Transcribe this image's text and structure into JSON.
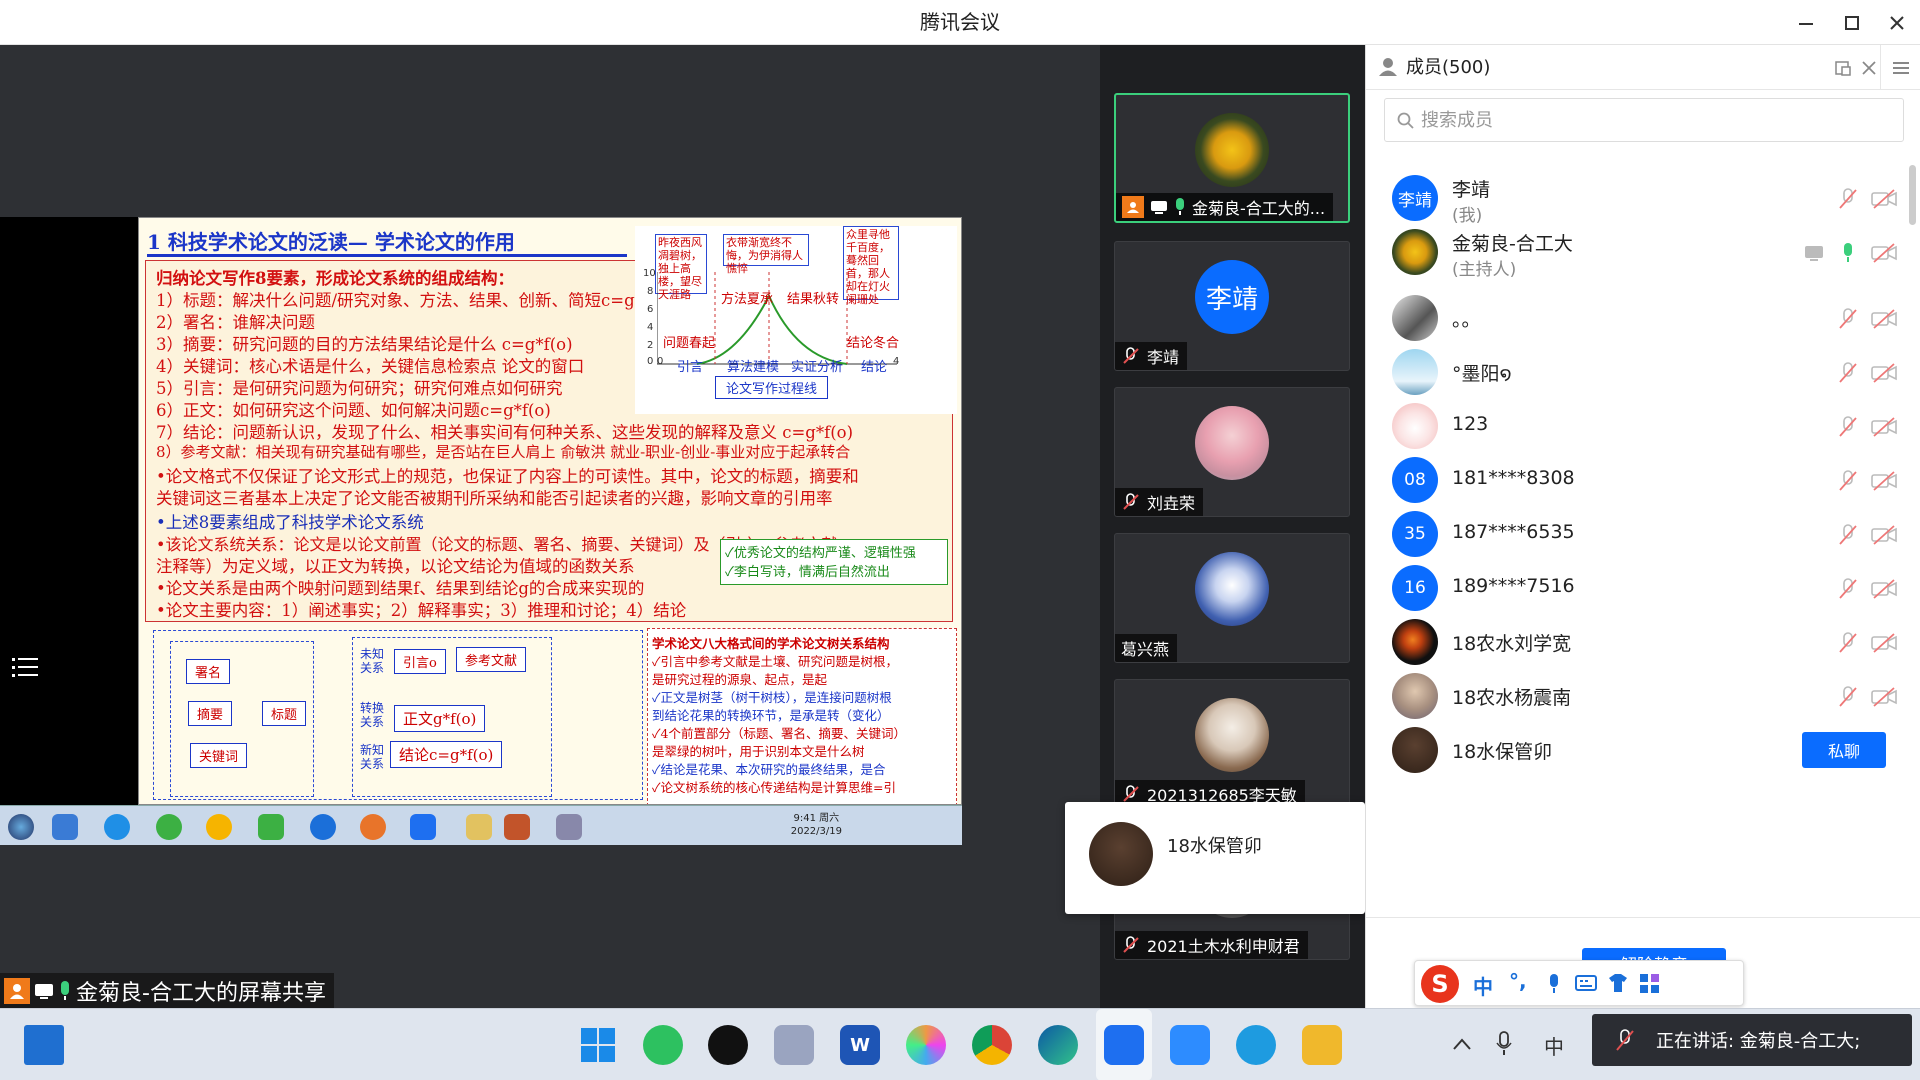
{
  "window": {
    "title": "腾讯会议"
  },
  "slide": {
    "title": "1 科技学术论文的泛读— 学术论文的作用",
    "lines": [
      "归纳论文写作8要素，形成论文系统的组成结构：",
      "1）标题：解决什么问题/研究对象、方法、结果、创新、简短c=g*f(o)",
      "2）署名：谁解决问题",
      "3）摘要：研究问题的目的方法结果结论是什么 c=g*f(o)",
      "4）关键词：核心术语是什么，关键信息检索点 论文的窗口",
      "5）引言：是何研究问题为何研究；研究何难点如何研究",
      "6）正文：如何研究这个问题、如何解决问题c=g*f(o)",
      "7）结论：问题新认识，发现了什么、相关事实间有何种关系、这些发现的解释及意义 c=g*f(o)",
      "8）参考文献：相关现有研究基础有哪些，是否站在巨人肩上 俞敏洪 就业-职业-创业-事业对应于起承转合",
      "•论文格式不仅保证了论文形式上的规范，也保证了内容上的可读性。其中，论文的标题，摘要和",
      "关键词这三者基本上决定了论文能否被期刊所采纳和能否引起读者的兴趣，影响文章的引用率",
      "•上述8要素组成了科技学术论文系统",
      "•该论文系统关系：论文是以论文前置（论文的标题、署名、摘要、关键词）及（引言、参考文献、",
      "注释等）为定义域，以正文为转换，以论文结论为值域的函数关系",
      "•论文关系是由两个映射问题到结果f、结果到结论g的合成来实现的",
      "•论文主要内容：1）阐述事实；2）解释事实；3）推理和讨论；4）结论"
    ],
    "chart": {
      "boxes": [
        "昨夜西风凋碧树，独上高楼，望尽天涯路",
        "衣带渐宽终不悔，为伊消得人憔悴",
        "众里寻他千百度，蓦然回首，那人却在灯火阑珊处"
      ],
      "stages": [
        "问题春起",
        "方法夏承",
        "结果秋转",
        "结论冬合"
      ],
      "xlabels": [
        "引言",
        "算法建模",
        "实证分析",
        "结论"
      ],
      "yticks": [
        "10",
        "8",
        "6",
        "4",
        "2",
        "0"
      ],
      "xticks": [
        "0",
        "4"
      ],
      "caption": "论文写作过程线"
    },
    "side_note": [
      "✓优秀论文的结构严谨、逻辑性强",
      "✓李白写诗，情满后自然流出"
    ],
    "diagram": {
      "boxes": [
        "署名",
        "摘要",
        "关键词",
        "标题",
        "引言o",
        "参考文献",
        "正文g*f(o)",
        "结论c=g*f(o)"
      ],
      "labels": [
        "未知关系",
        "转换关系",
        "新知关系"
      ]
    },
    "right_lines": [
      "学术论文八大格式间的学术论文树关系结构",
      "✓引言中参考文献是土壤、研究问题是树根，",
      "是研究过程的源泉、起点，是起",
      "✓正文是树茎（树干树枝），是连接问题树根",
      "到结论花果的转换环节，是承是转（变化）",
      "✓4个前置部分（标题、署名、摘要、关键词）",
      "是翠绿的树叶，用于识别本文是什么树",
      "✓结论是花果、本次研究的最终结果，是合",
      "✓论文树系统的核心传递结构是计算思维=引"
    ],
    "clock": {
      "time": "9:41 周六",
      "date": "2022/3/19"
    }
  },
  "presenter": {
    "label": "金菊良-合工大的屏幕共享"
  },
  "tiles": [
    {
      "name": "金菊良-合工大的..."
    },
    {
      "name": "李靖",
      "avatar_text": "李靖"
    },
    {
      "name": "刘垚荣"
    },
    {
      "name": "葛兴燕"
    },
    {
      "name": "2021312685李天敏"
    },
    {
      "name": "2021土木水利申财君"
    }
  ],
  "popup": {
    "name": "18水保管卯"
  },
  "members": {
    "title": "成员(500)",
    "search_placeholder": "搜索成员",
    "rows": [
      {
        "name": "李靖",
        "sub": "(我)",
        "avatar_text": "李靖"
      },
      {
        "name": "金菊良-合工大",
        "sub": "(主持人)"
      },
      {
        "name": "。。"
      },
      {
        "name": "°墨阳໑"
      },
      {
        "name": "123"
      },
      {
        "name": "181****8308",
        "avatar_text": "08"
      },
      {
        "name": "187****6535",
        "avatar_text": "35"
      },
      {
        "name": "189****7516",
        "avatar_text": "16"
      },
      {
        "name": "18农水刘学宽"
      },
      {
        "name": "18农水杨震南"
      },
      {
        "name": "18水保管卯",
        "action": "私聊"
      }
    ],
    "unmute_all": "解除静音"
  },
  "ime": {
    "mode": "中",
    "punct": "°,"
  },
  "speaking": {
    "text": "正在讲话: 金菊良-合工大;"
  },
  "colors": {
    "accent": "#0a6cff",
    "active_border": "#3bcf7c",
    "muted_red": "#e05050"
  }
}
